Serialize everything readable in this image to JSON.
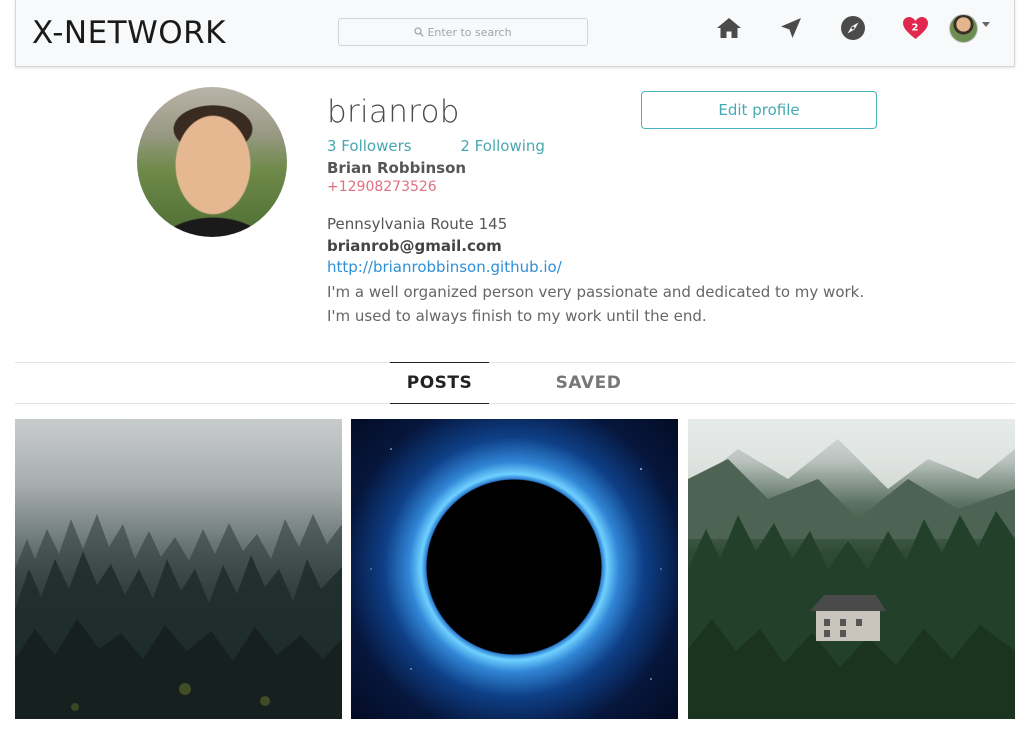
{
  "navbar": {
    "brand": "X-NETWORK",
    "search_placeholder": "Enter to search",
    "icons": [
      "home-icon",
      "send-icon",
      "compass-icon",
      "heart-icon",
      "avatar"
    ],
    "notifications_count": "2",
    "heart_color": "#e0284e"
  },
  "profile": {
    "username": "brianrob",
    "edit_button": "Edit profile",
    "followers": "3 Followers",
    "following": "2 Following",
    "full_name": "Brian Robbinson",
    "phone": "+12908273526",
    "address": "Pennsylvania Route 145",
    "email": "brianrob@gmail.com",
    "website": "http://brianrobbinson.github.io/",
    "bio": "I'm a well organized person very passionate and dedicated to my work. I'm used to always finish to my work until the end."
  },
  "tabs": [
    {
      "label": "POSTS",
      "active": true
    },
    {
      "label": "SAVED",
      "active": false
    }
  ],
  "posts": [
    "misty forest",
    "black hole",
    "house in forest"
  ],
  "colors": {
    "accent": "#45b6bf",
    "link": "#2f8fd6",
    "phone": "#e0707f"
  }
}
